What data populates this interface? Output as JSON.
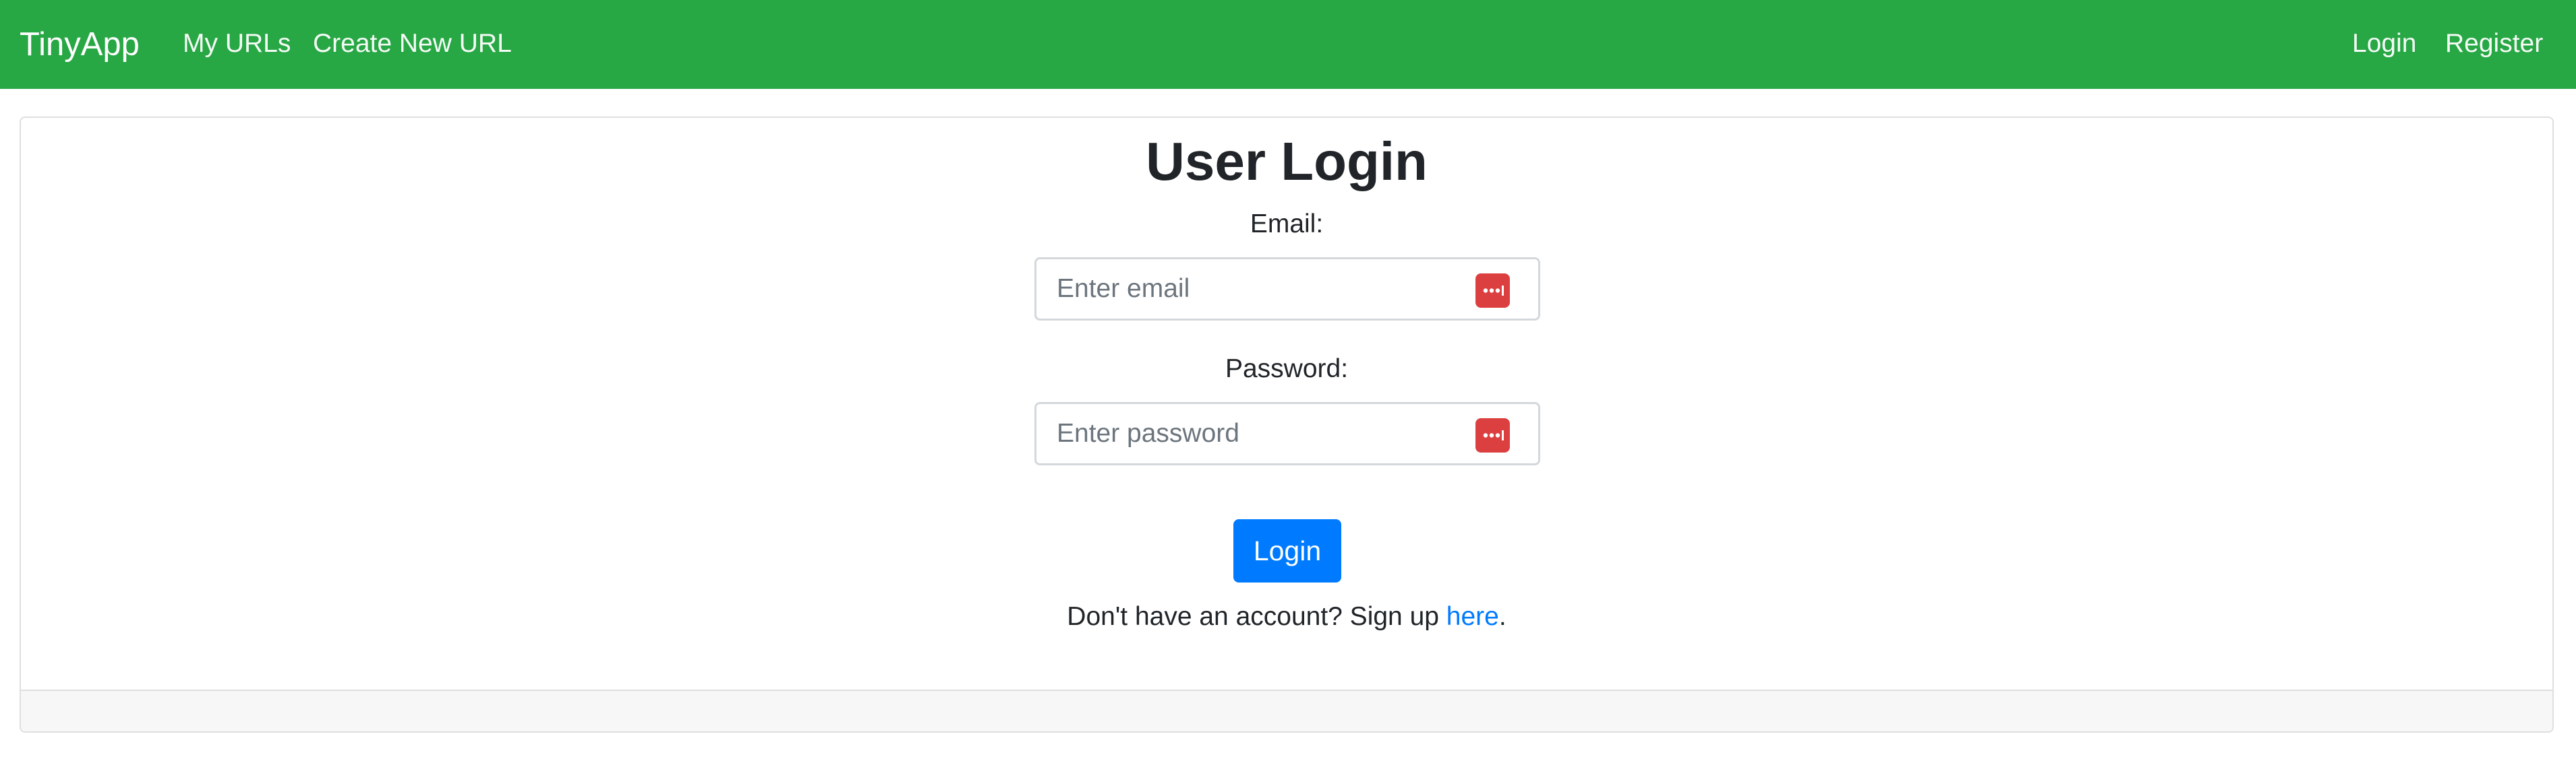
{
  "navbar": {
    "brand": "TinyApp",
    "links": {
      "my_urls": "My URLs",
      "create_new_url": "Create New URL",
      "login": "Login",
      "register": "Register"
    },
    "background_color": "#28a745"
  },
  "login_form": {
    "title": "User Login",
    "email": {
      "label": "Email:",
      "placeholder": "Enter email",
      "value": ""
    },
    "password": {
      "label": "Password:",
      "placeholder": "Enter password",
      "value": ""
    },
    "password_manager_icon": "password-manager-icon",
    "submit_label": "Login",
    "signup_prompt": "Don't have an account? Sign up ",
    "signup_link": "here",
    "signup_suffix": "."
  },
  "colors": {
    "primary": "#007bff",
    "password_manager": "#dc3f3f"
  }
}
